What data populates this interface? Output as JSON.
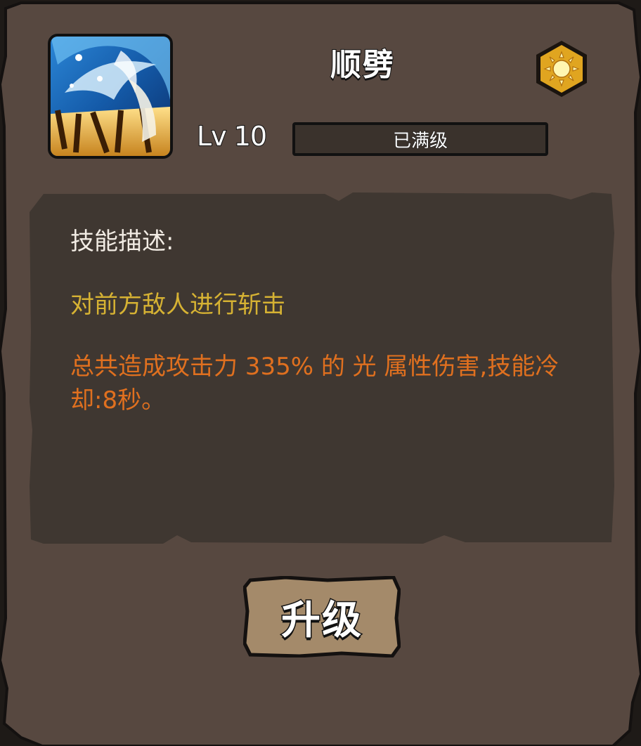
{
  "skill": {
    "name": "顺劈",
    "icon": "slash-skill-icon",
    "element_icon": "sun-icon",
    "element_color": "#e0a520"
  },
  "level": {
    "label": "Lv 10",
    "status": "已满级",
    "progress": 1.0
  },
  "description": {
    "title": "技能描述:",
    "line1": "对前方敌人进行斩击",
    "line2": "总共造成攻击力 335% 的 光 属性伤害,技能冷却:8秒。",
    "line1_color": "#d6b233",
    "line2_color": "#e0701f"
  },
  "actions": {
    "upgrade_label": "升级"
  },
  "colors": {
    "panel": "#574840",
    "desc_box": "#3f3731",
    "button": "#a48a6a"
  }
}
